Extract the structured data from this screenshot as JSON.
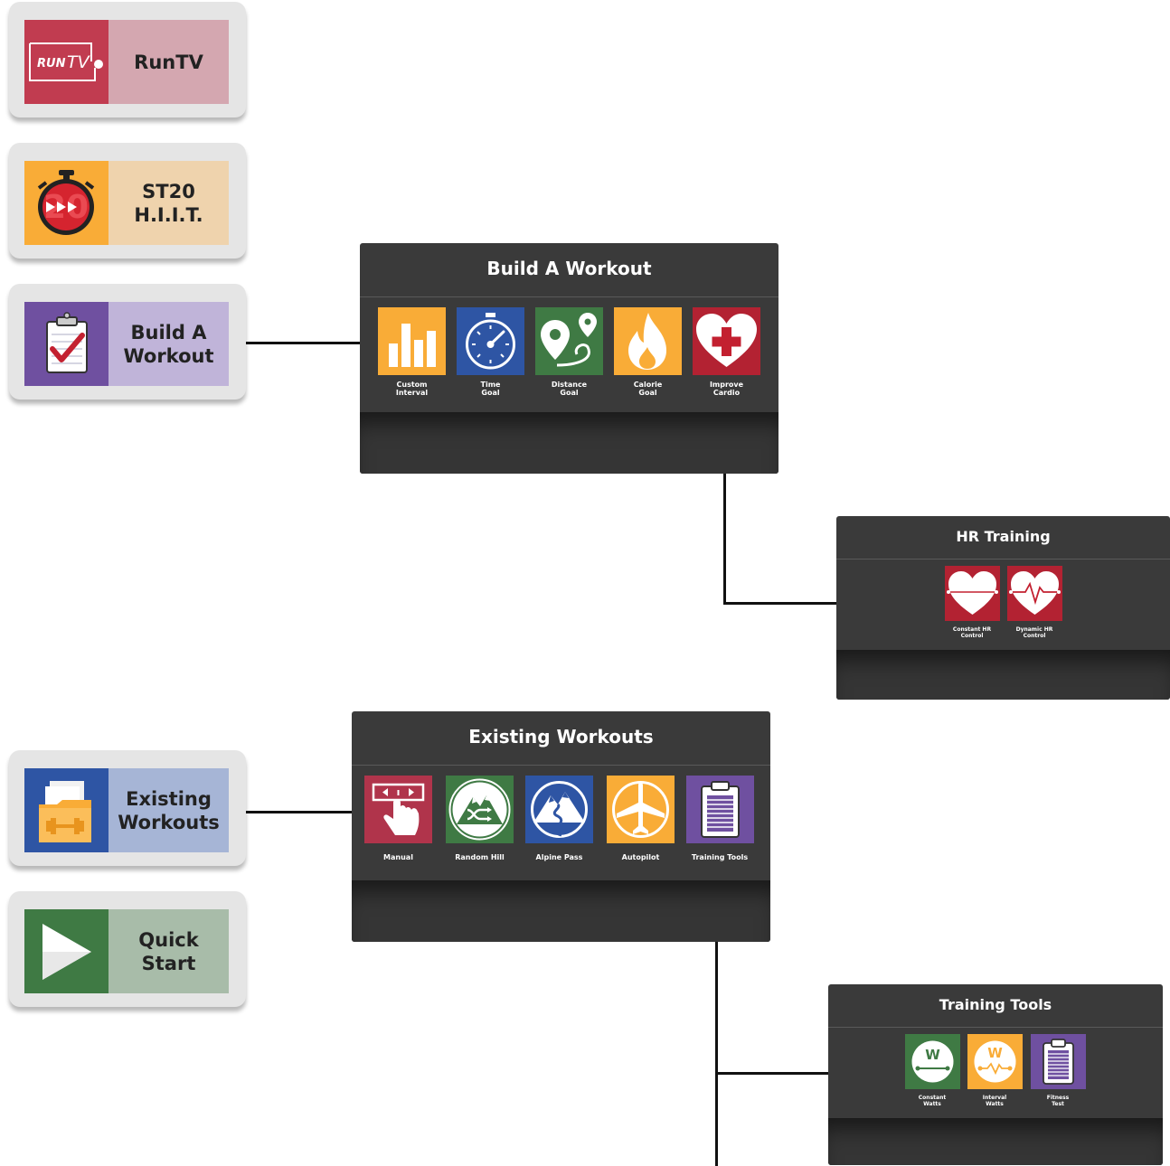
{
  "menu_tiles": {
    "runtv": {
      "label": "RunTV",
      "logo_text": "RUN",
      "logo_suffix": "TV"
    },
    "st20": {
      "line1": "ST20",
      "line2": "H.I.I.T."
    },
    "build": {
      "line1": "Build A",
      "line2": "Workout"
    },
    "existing": {
      "line1": "Existing",
      "line2": "Workouts"
    },
    "quick": {
      "line1": "Quick",
      "line2": "Start"
    }
  },
  "panels": {
    "build_workout": {
      "title": "Build A Workout",
      "items": [
        {
          "line1": "Custom",
          "line2": "Interval",
          "icon": "bar-chart-icon",
          "color": "#f9ac37"
        },
        {
          "line1": "Time",
          "line2": "Goal",
          "icon": "stopwatch-icon",
          "color": "#2e55a4"
        },
        {
          "line1": "Distance",
          "line2": "Goal",
          "icon": "map-pin-icon",
          "color": "#3f7a44"
        },
        {
          "line1": "Calorie",
          "line2": "Goal",
          "icon": "flame-icon",
          "color": "#f9ac37"
        },
        {
          "line1": "Improve",
          "line2": "Cardio",
          "icon": "heart-cross-icon",
          "color": "#b32232"
        }
      ]
    },
    "hr_training": {
      "title": "HR Training",
      "items": [
        {
          "line1": "Constant HR",
          "line2": "Control",
          "icon": "heart-flat-icon",
          "color": "#b32232"
        },
        {
          "line1": "Dynamic HR",
          "line2": "Control",
          "icon": "heart-pulse-icon",
          "color": "#b32232"
        }
      ]
    },
    "existing_workouts": {
      "title": "Existing Workouts",
      "items": [
        {
          "label": "Manual",
          "icon": "manual-touch-icon",
          "color": "#b0344b"
        },
        {
          "label": "Random Hill",
          "icon": "random-hill-icon",
          "color": "#3f7a44"
        },
        {
          "label": "Alpine Pass",
          "icon": "alpine-pass-icon",
          "color": "#2e55a4"
        },
        {
          "label": "Autopilot",
          "icon": "airplane-icon",
          "color": "#f9ac37"
        },
        {
          "label": "Training Tools",
          "icon": "clipboard-list-icon",
          "color": "#6f50a0"
        }
      ]
    },
    "training_tools": {
      "title": "Training Tools",
      "items": [
        {
          "line1": "Constant",
          "line2": "Watts",
          "icon": "constant-watts-icon",
          "color": "#3f7a44",
          "glyph": "W"
        },
        {
          "line1": "Interval",
          "line2": "Watts",
          "icon": "interval-watts-icon",
          "color": "#f9ac37",
          "glyph": "W"
        },
        {
          "line1": "Fitness",
          "line2": "Test",
          "icon": "clipboard-list-icon",
          "color": "#6f50a0"
        }
      ]
    }
  },
  "colors": {
    "runtv": "#c13c50",
    "runtv_light": "#d4a7b0",
    "st20": "#f9ac37",
    "st20_light": "#efd3ad",
    "build": "#6f50a0",
    "build_light": "#c0b4d9",
    "existing": "#2e55a4",
    "existing_light": "#a6b5d6",
    "quick": "#3f7a44",
    "quick_light": "#a8bca9",
    "panel_bg": "#3a3a3a",
    "connector": "#111111"
  }
}
